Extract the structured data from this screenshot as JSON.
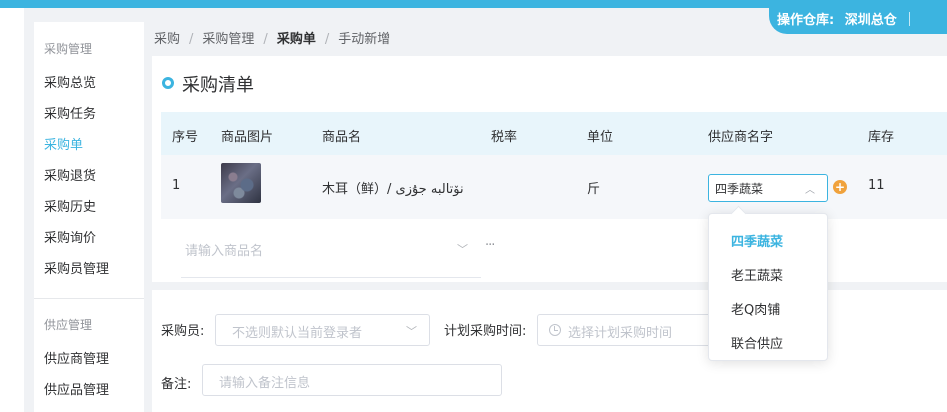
{
  "header": {
    "warehouse_label": "操作仓库:",
    "warehouse_value": "深圳总仓"
  },
  "sidebar": {
    "group1": "采购管理",
    "items1": [
      "采购总览",
      "采购任务",
      "采购单",
      "采购退货",
      "采购历史",
      "采购询价",
      "采购员管理"
    ],
    "active": "采购单",
    "group2": "供应管理",
    "items2": [
      "供应商管理",
      "供应品管理"
    ]
  },
  "breadcrumb": [
    "采购",
    "采购管理",
    "采购单",
    "手动新增"
  ],
  "section": {
    "title": "采购清单"
  },
  "table": {
    "headers": [
      "序号",
      "商品图片",
      "商品名",
      "税率",
      "单位",
      "供应商名字",
      "库存"
    ],
    "row": {
      "index": "1",
      "name": "木耳（鲜）/ نۆتالبە جۇزى",
      "tax": "",
      "unit": "斤",
      "supplier": "四季蔬菜",
      "stock": "11"
    },
    "add_placeholder": "请输入商品名",
    "add_more": "···"
  },
  "supplier_dropdown": {
    "options": [
      "四季蔬菜",
      "老王蔬菜",
      "老Q肉铺",
      "联合供应"
    ],
    "selected": "四季蔬菜"
  },
  "form": {
    "buyer_label": "采购员:",
    "buyer_placeholder": "不选则默认当前登录者",
    "time_label": "计划采购时间:",
    "time_placeholder": "选择计划采购时间",
    "note_label": "备注:",
    "note_placeholder": "请输入备注信息"
  },
  "colors": {
    "accent": "#3cb4e0",
    "plus": "#f0a23c"
  }
}
